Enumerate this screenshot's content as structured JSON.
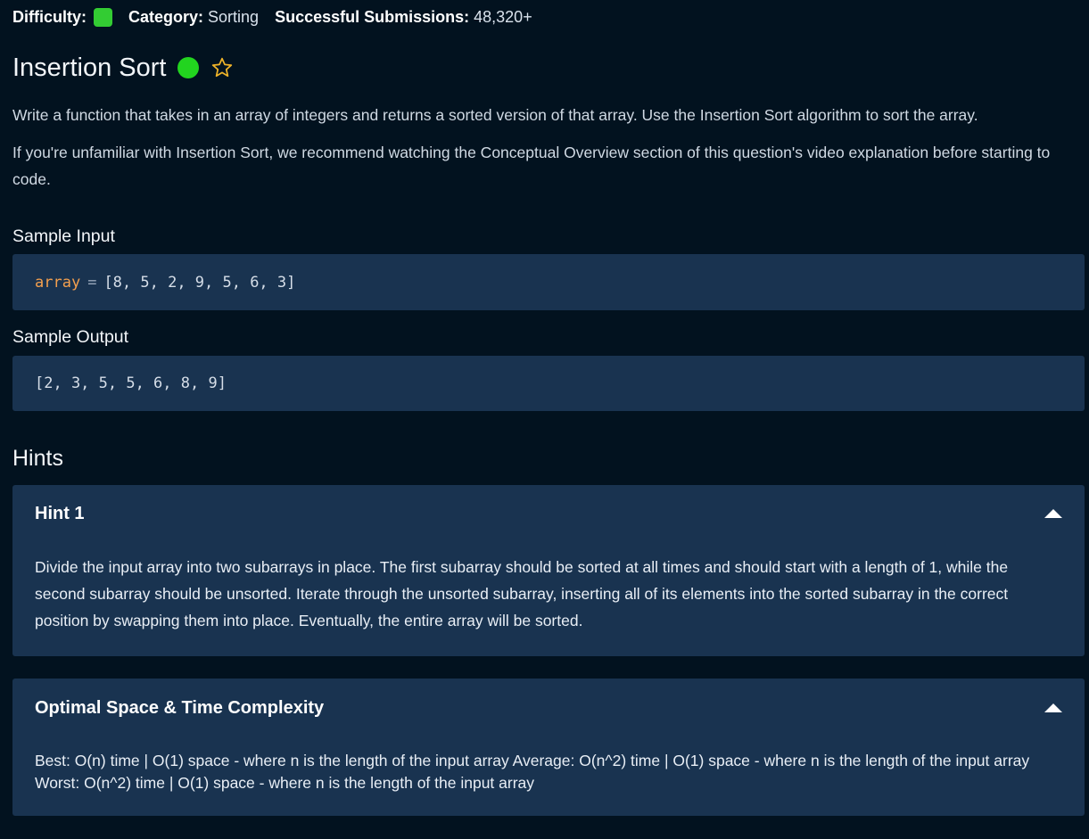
{
  "meta": {
    "difficulty_label": "Difficulty:",
    "difficulty_color": "#33cc33",
    "category_label": "Category:",
    "category_value": "Sorting",
    "submissions_label": "Successful Submissions:",
    "submissions_value": "48,320+"
  },
  "title": "Insertion Sort",
  "status_color": "#22d41f",
  "star_icon": "star-outline-icon",
  "description": {
    "p1": "Write a function that takes in an array of integers and returns a sorted version of that array. Use the Insertion Sort algorithm to sort the array.",
    "p2": "If you're unfamiliar with Insertion Sort, we recommend watching the Conceptual Overview section of this question's video explanation before starting to code."
  },
  "sample_input": {
    "label": "Sample Input",
    "var": "array",
    "op": "=",
    "value": "[8, 5, 2, 9, 5, 6, 3]"
  },
  "sample_output": {
    "label": "Sample Output",
    "value": "[2, 3, 5, 5, 6, 8, 9]"
  },
  "hints": {
    "heading": "Hints",
    "items": [
      {
        "title": "Hint 1",
        "body": "Divide the input array into two subarrays in place. The first subarray should be sorted at all times and should start with a length of 1, while the second subarray should be unsorted. Iterate through the unsorted subarray, inserting all of its elements into the sorted subarray in the correct position by swapping them into place. Eventually, the entire array will be sorted."
      },
      {
        "title": "Optimal Space & Time Complexity",
        "body": "Best: O(n) time | O(1) space - where n is the length of the input array Average: O(n^2) time | O(1) space - where n is the length of the input array Worst: O(n^2) time | O(1) space - where n is the length of the input array"
      }
    ]
  }
}
